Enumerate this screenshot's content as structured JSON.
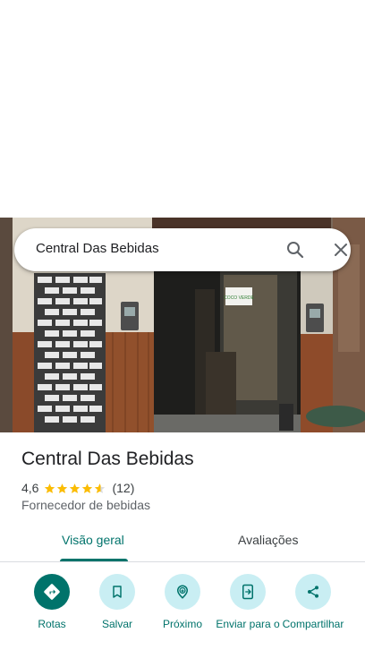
{
  "search": {
    "query": "Central Das Bebidas",
    "search_icon": "search-icon",
    "close_icon": "close-icon"
  },
  "photo": {
    "sign_text": "COCO VERDE"
  },
  "place": {
    "name": "Central Das Bebidas",
    "rating": "4,6",
    "rating_stars": 4.6,
    "review_count": "(12)",
    "category": "Fornecedor de bebidas"
  },
  "tabs": [
    {
      "label": "Visão geral",
      "selected": true
    },
    {
      "label": "Avaliações",
      "selected": false
    }
  ],
  "actions": [
    {
      "label": "Rotas",
      "icon": "directions-icon"
    },
    {
      "label": "Salvar",
      "icon": "bookmark-icon"
    },
    {
      "label": "Próximo",
      "icon": "nearby-icon"
    },
    {
      "label": "Enviar para o",
      "icon": "send-to-phone-icon"
    },
    {
      "label": "Compartilhar",
      "icon": "share-icon"
    }
  ],
  "colors": {
    "accent": "#00736b",
    "action_bg": "#c9eef3",
    "star": "#fbbc04"
  }
}
